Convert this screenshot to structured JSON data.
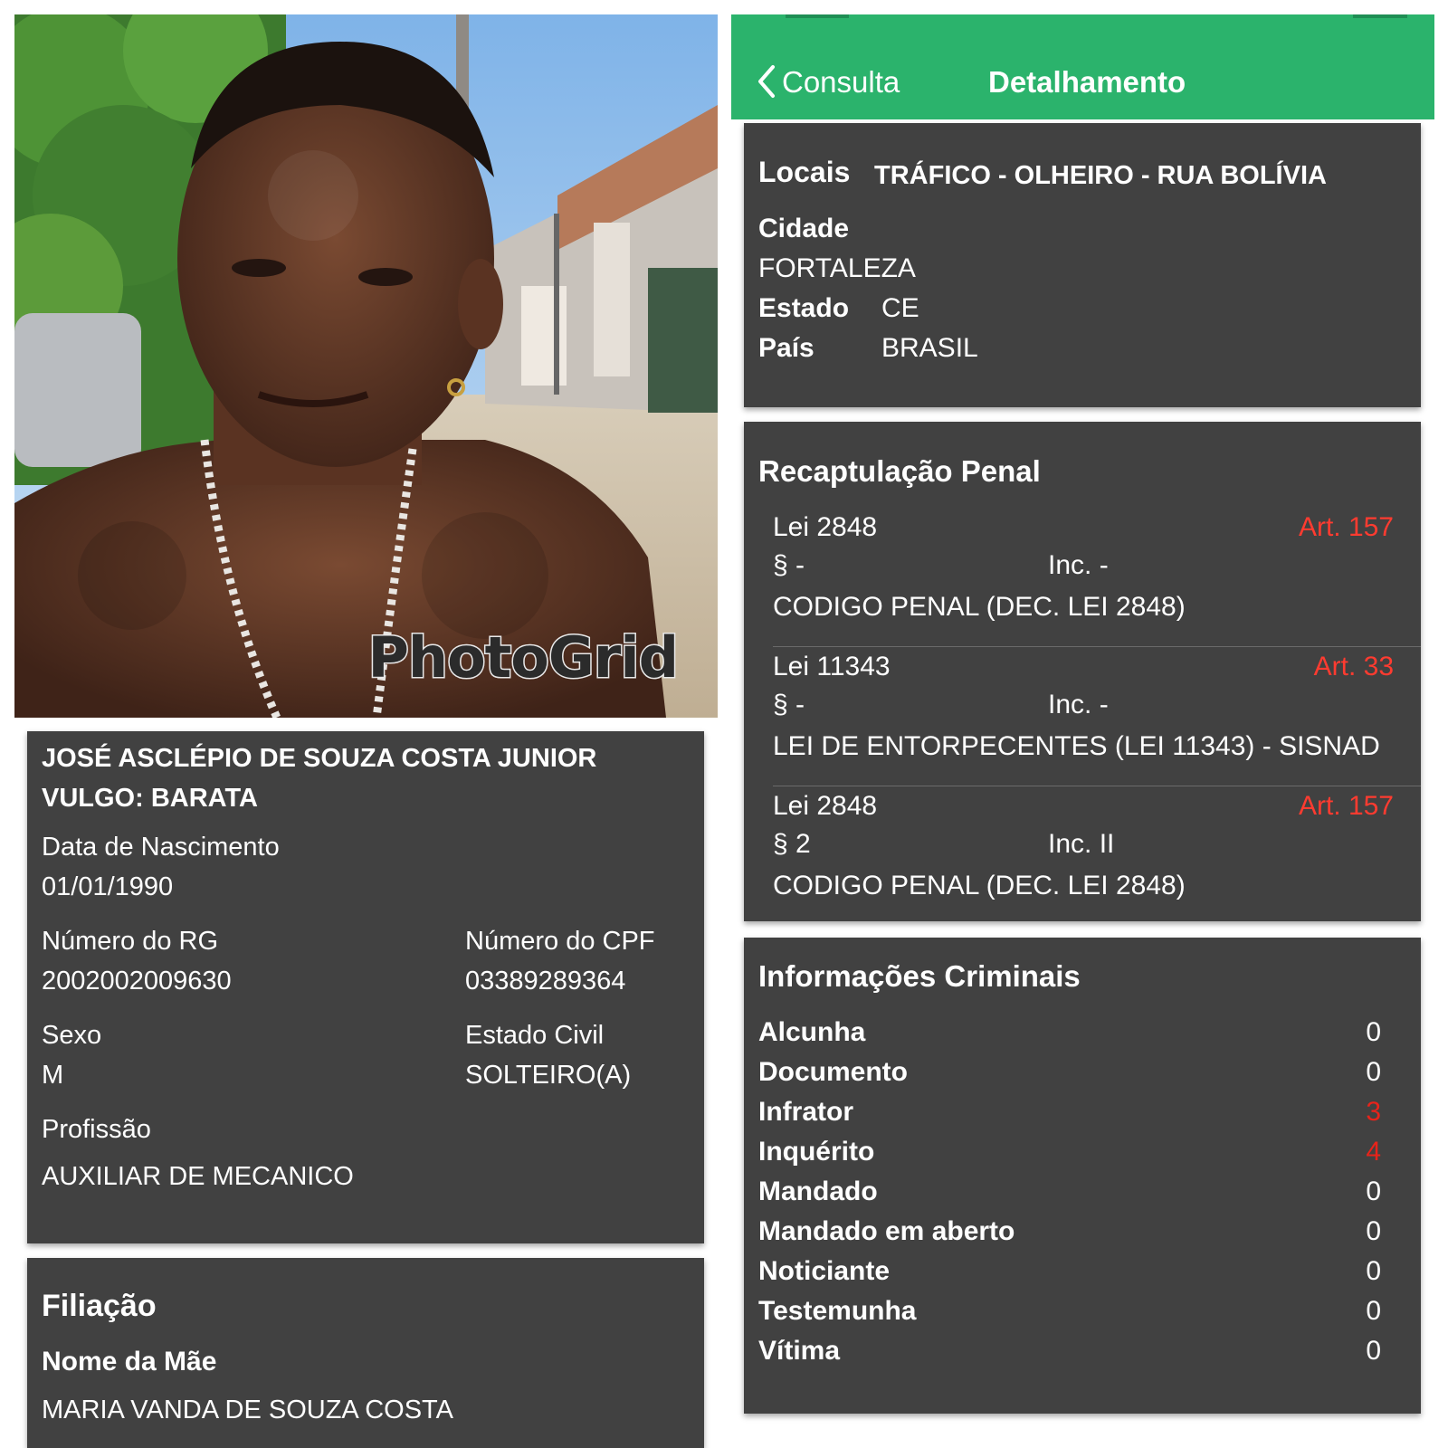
{
  "photo": {
    "watermark": "PhotoGrid"
  },
  "person": {
    "name": "JOSÉ ASCLÉPIO DE SOUZA COSTA JUNIOR",
    "alias": "VULGO: BARATA",
    "birth_label": "Data de Nascimento",
    "birth_value": "01/01/1990",
    "rg_label": "Número do RG",
    "rg_value": "2002002009630",
    "cpf_label": "Número do CPF",
    "cpf_value": "03389289364",
    "sex_label": "Sexo",
    "sex_value": "M",
    "civil_label": "Estado Civil",
    "civil_value": "SOLTEIRO(A)",
    "profession_label": "Profissão",
    "profession_value": "AUXILIAR DE MECANICO"
  },
  "filiation": {
    "title": "Filiação",
    "mother_label": "Nome da Mãe",
    "mother_value": "MARIA VANDA DE SOUZA COSTA"
  },
  "appbar": {
    "back_label": "Consulta",
    "title": "Detalhamento",
    "accent": "#2bb36c"
  },
  "location": {
    "locais_label": "Locais",
    "locais_value": "TRÁFICO - OLHEIRO - RUA BOLÍVIA",
    "city_label": "Cidade",
    "city_value": "FORTALEZA",
    "state_label": "Estado",
    "state_value": "CE",
    "country_label": "País",
    "country_value": "BRASIL"
  },
  "penal": {
    "title": "Recaptulação Penal",
    "items": [
      {
        "law": "Lei 2848",
        "article": "Art. 157",
        "paragraph": "§ -",
        "inc": "Inc. -",
        "description": "CODIGO PENAL (DEC. LEI 2848)"
      },
      {
        "law": "Lei 11343",
        "article": "Art. 33",
        "paragraph": "§ -",
        "inc": "Inc. -",
        "description": "LEI DE ENTORPECENTES (LEI 11343) - SISNAD"
      },
      {
        "law": "Lei 2848",
        "article": "Art. 157",
        "paragraph": "§ 2",
        "inc": "Inc. II",
        "description": "CODIGO PENAL (DEC. LEI 2848)"
      }
    ]
  },
  "criminal": {
    "title": "Informações Criminais",
    "highlight_color": "#e8231a",
    "rows": [
      {
        "label": "Alcunha",
        "value": "0"
      },
      {
        "label": "Documento",
        "value": "0"
      },
      {
        "label": "Infrator",
        "value": "3"
      },
      {
        "label": "Inquérito",
        "value": "4"
      },
      {
        "label": "Mandado",
        "value": "0"
      },
      {
        "label": "Mandado em aberto",
        "value": "0"
      },
      {
        "label": "Noticiante",
        "value": "0"
      },
      {
        "label": "Testemunha",
        "value": "0"
      },
      {
        "label": "Vítima",
        "value": "0"
      }
    ]
  }
}
